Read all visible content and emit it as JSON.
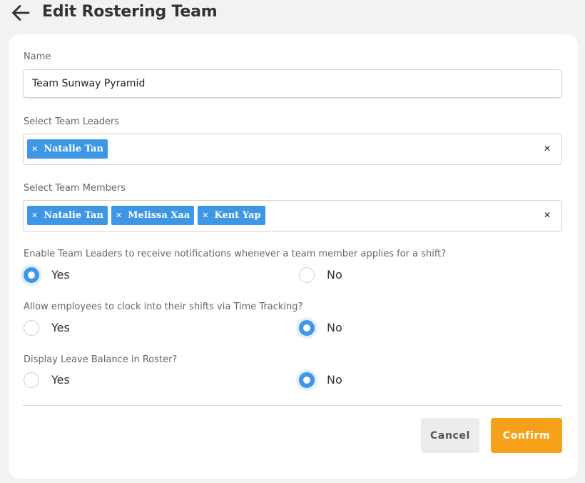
{
  "header": {
    "title": "Edit Rostering Team",
    "back_icon": "arrow-left-icon"
  },
  "form": {
    "name": {
      "label": "Name",
      "value": "Team Sunway Pyramid"
    },
    "team_leaders": {
      "label": "Select Team Leaders",
      "selected": [
        "Natalie Tan"
      ]
    },
    "team_members": {
      "label": "Select Team Members",
      "selected": [
        "Natalie Tan",
        "Melissa Xaa",
        "Kent Yap"
      ]
    },
    "notify_leaders": {
      "question": "Enable Team Leaders to receive notifications whenever a team member applies for a shift?",
      "yes_label": "Yes",
      "no_label": "No",
      "value": "Yes"
    },
    "clock_in": {
      "question": "Allow employees to clock into their shifts via Time Tracking?",
      "yes_label": "Yes",
      "no_label": "No",
      "value": "No"
    },
    "leave_balance": {
      "question": "Display Leave Balance in Roster?",
      "yes_label": "Yes",
      "no_label": "No",
      "value": "No"
    }
  },
  "actions": {
    "cancel_label": "Cancel",
    "confirm_label": "Confirm"
  },
  "colors": {
    "accent": "#3d96e6",
    "confirm": "#f7a11a",
    "background": "#f2f2f2"
  }
}
